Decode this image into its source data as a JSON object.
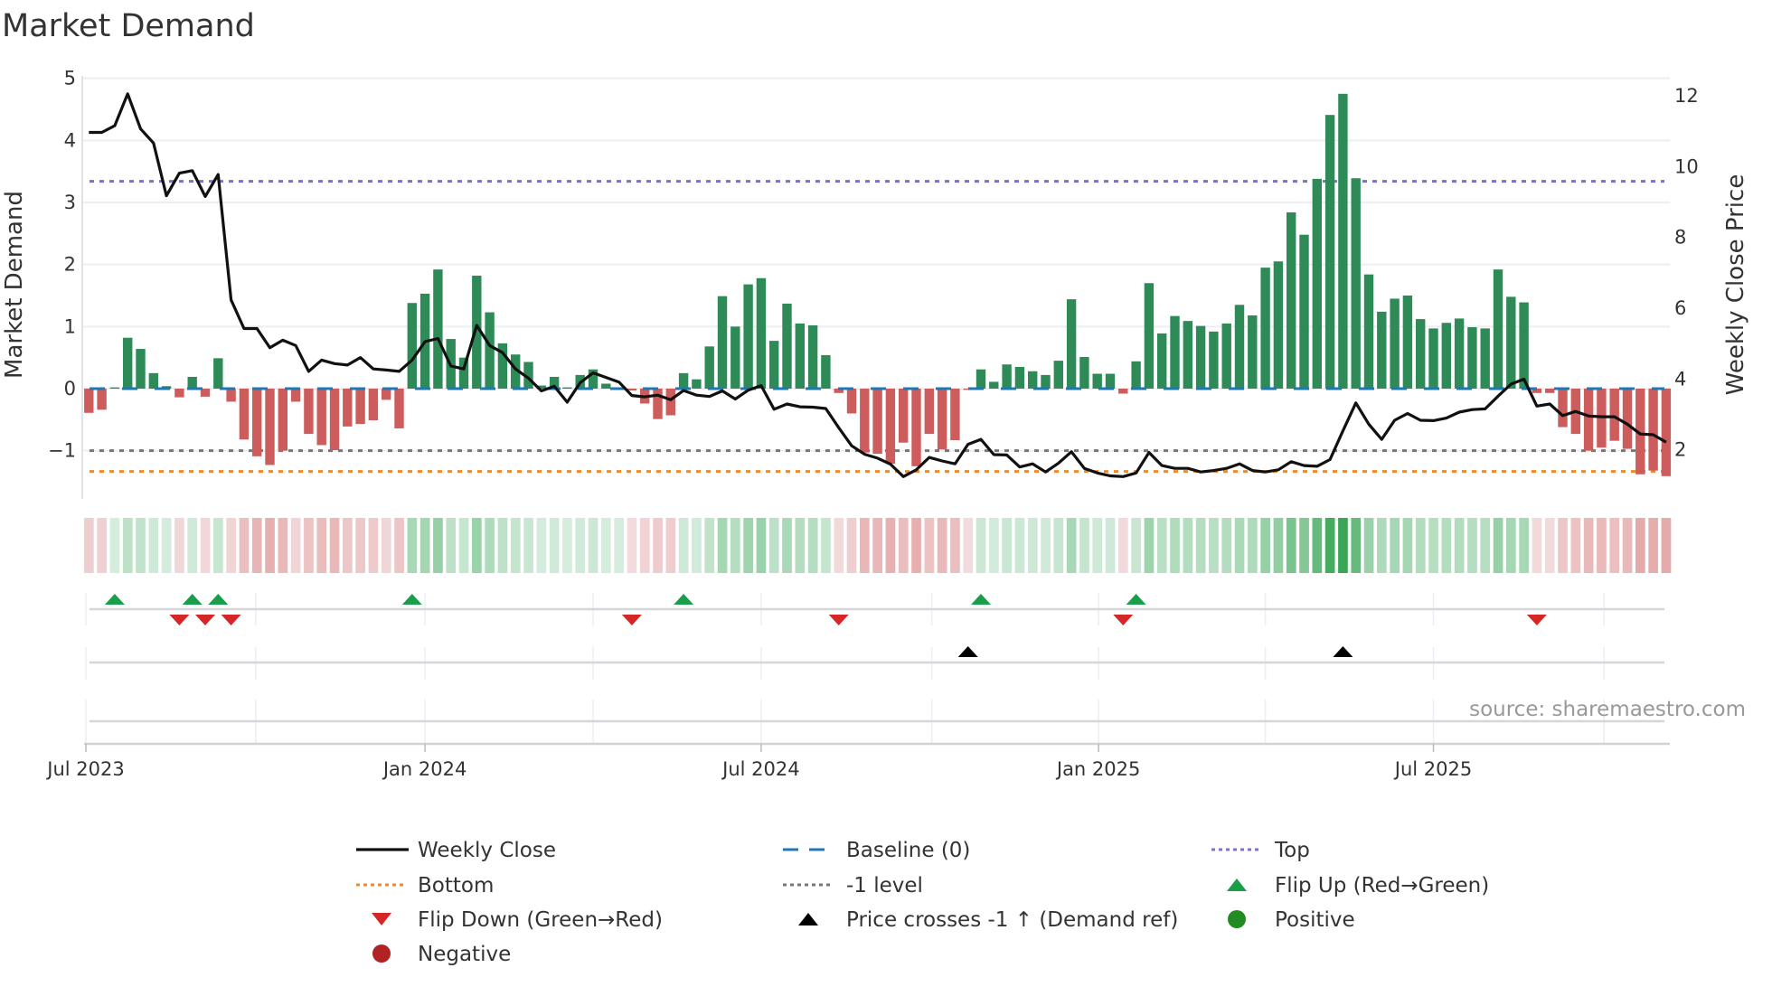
{
  "chart_data": {
    "type": "bar",
    "title": "Market Demand",
    "ylabel": "Market Demand",
    "y2label": "Weekly Close Price",
    "ylim": [
      -1.6,
      5.1
    ],
    "y2lim": [
      0.6,
      12.5
    ],
    "yticks": [
      -1,
      0,
      1,
      2,
      3,
      4,
      5
    ],
    "yticklabels": [
      "−1",
      "0",
      "1",
      "2",
      "3",
      "4",
      "5"
    ],
    "y2ticks": [
      2,
      4,
      6,
      8,
      10,
      12
    ],
    "y2ticklabels": [
      "2",
      "4",
      "6",
      "8",
      "10",
      "12"
    ],
    "x_unit": "week index",
    "xticks": [
      {
        "x": -0.23,
        "label": "Jul 2023"
      },
      {
        "x": 26.0,
        "label": "Jan 2024"
      },
      {
        "x": 52.0,
        "label": "Jul 2024"
      },
      {
        "x": 78.1,
        "label": "Jan 2025"
      },
      {
        "x": 104.0,
        "label": "Jul 2025"
      }
    ],
    "x_minor_grid": [
      -0.23,
      12.9,
      26.0,
      39.0,
      52.0,
      65.2,
      78.1,
      91.0,
      104.0,
      117.2
    ],
    "demand": [
      -0.39,
      -0.34,
      0.02,
      0.82,
      0.64,
      0.25,
      0.04,
      -0.14,
      0.19,
      -0.13,
      0.49,
      -0.21,
      -0.82,
      -1.09,
      -1.23,
      -1.0,
      -0.21,
      -0.73,
      -0.91,
      -0.99,
      -0.61,
      -0.57,
      -0.51,
      -0.18,
      -0.64,
      1.38,
      1.53,
      1.92,
      0.8,
      0.5,
      1.82,
      1.23,
      0.73,
      0.55,
      0.43,
      0.05,
      0.19,
      0.02,
      0.22,
      0.31,
      0.08,
      0.02,
      -0.03,
      -0.24,
      -0.49,
      -0.43,
      0.25,
      0.15,
      0.68,
      1.49,
      1.0,
      1.68,
      1.78,
      0.77,
      1.37,
      1.05,
      1.02,
      0.54,
      -0.07,
      -0.4,
      -1.03,
      -1.05,
      -1.21,
      -0.87,
      -1.25,
      -0.73,
      -0.98,
      -0.83,
      -0.02,
      0.31,
      0.11,
      0.39,
      0.35,
      0.28,
      0.22,
      0.45,
      1.44,
      0.51,
      0.24,
      0.24,
      -0.08,
      0.44,
      1.7,
      0.89,
      1.17,
      1.09,
      1.01,
      0.92,
      1.05,
      1.35,
      1.18,
      1.95,
      2.05,
      2.84,
      2.48,
      3.38,
      4.41,
      4.75,
      3.39,
      1.84,
      1.24,
      1.45,
      1.5,
      1.12,
      0.97,
      1.06,
      1.13,
      0.99,
      0.97,
      1.92,
      1.48,
      1.39,
      -0.07,
      -0.07,
      -0.62,
      -0.73,
      -1.0,
      -0.95,
      -0.84,
      -0.97,
      -1.38,
      -1.32,
      -1.41
    ],
    "weekly_close": [
      10.94,
      10.94,
      11.13,
      12.03,
      11.04,
      10.64,
      9.15,
      9.79,
      9.86,
      9.13,
      9.75,
      6.21,
      5.4,
      5.4,
      4.86,
      5.07,
      4.92,
      4.19,
      4.51,
      4.41,
      4.37,
      4.58,
      4.26,
      4.23,
      4.19,
      4.51,
      5.03,
      5.12,
      4.34,
      4.26,
      5.49,
      4.92,
      4.72,
      4.26,
      4.0,
      3.64,
      3.77,
      3.32,
      3.87,
      4.15,
      4.02,
      3.89,
      3.51,
      3.47,
      3.52,
      3.39,
      3.65,
      3.52,
      3.48,
      3.64,
      3.41,
      3.66,
      3.79,
      3.12,
      3.27,
      3.19,
      3.18,
      3.14,
      2.6,
      2.09,
      1.85,
      1.74,
      1.57,
      1.22,
      1.41,
      1.76,
      1.66,
      1.58,
      2.13,
      2.27,
      1.84,
      1.83,
      1.49,
      1.58,
      1.35,
      1.6,
      1.92,
      1.45,
      1.32,
      1.24,
      1.22,
      1.32,
      1.9,
      1.53,
      1.45,
      1.45,
      1.35,
      1.39,
      1.45,
      1.58,
      1.39,
      1.35,
      1.41,
      1.64,
      1.53,
      1.51,
      1.7,
      2.51,
      3.3,
      2.7,
      2.27,
      2.81,
      3.0,
      2.81,
      2.8,
      2.87,
      3.04,
      3.11,
      3.13,
      3.49,
      3.83,
      3.97,
      3.21,
      3.27,
      2.94,
      3.06,
      2.93,
      2.91,
      2.91,
      2.7,
      2.42,
      2.4,
      2.19
    ],
    "levels": {
      "baseline": 0,
      "top": 3.34,
      "bottom": -1.335,
      "minus_one": -1
    },
    "flip_up": [
      2,
      8,
      10,
      25,
      46,
      69,
      81
    ],
    "flip_down": [
      7,
      9,
      11,
      42,
      58,
      80,
      112
    ],
    "price_cross_up": [
      68,
      97
    ],
    "colors": {
      "positive_bar": "#2e8b57",
      "negative_bar": "#cd5c5c",
      "line": "#111111",
      "baseline": "#1f77b4",
      "top": "#7b6fd0",
      "bottom": "#ee8a2a",
      "minus_one": "#777777",
      "flip_up": "#1a9e4a",
      "flip_down": "#d62728",
      "cross": "#000000",
      "positive_dot": "#228b22",
      "negative_dot": "#b22222"
    },
    "legend": [
      {
        "label": "Weekly Close",
        "kind": "line"
      },
      {
        "label": "Baseline (0)",
        "kind": "baseline"
      },
      {
        "label": "Top",
        "kind": "top"
      },
      {
        "label": "Bottom",
        "kind": "bottom"
      },
      {
        "label": "-1 level",
        "kind": "minus_one"
      },
      {
        "label": "Flip Up (Red→Green)",
        "kind": "flip_up"
      },
      {
        "label": "Flip Down (Green→Red)",
        "kind": "flip_down"
      },
      {
        "label": "Price crosses -1 ↑ (Demand ref)",
        "kind": "cross"
      },
      {
        "label": "Positive",
        "kind": "positive_dot"
      },
      {
        "label": "Negative",
        "kind": "negative_dot"
      }
    ],
    "legend_placement": "bottom-center",
    "source": "source: sharemaestro.com"
  }
}
